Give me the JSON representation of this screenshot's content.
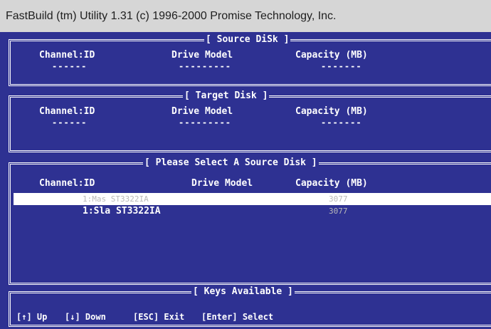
{
  "title_bar": "FastBuild (tm) Utility 1.31 (c) 1996-2000 Promise Technology, Inc.",
  "colors": {
    "background": "#2e3192",
    "text": "#ffffff",
    "dim_text": "#b9b9b9",
    "title_bar": "#d6d6d6"
  },
  "source_panel": {
    "title": "[ Source DiSk ]",
    "headers": {
      "channel": "Channel:ID",
      "model": "Drive Model",
      "capacity": "Capacity (MB)"
    },
    "placeholders": {
      "channel": "------",
      "model": "---------",
      "capacity": "-------"
    }
  },
  "target_panel": {
    "title": "[ Target Disk ]",
    "headers": {
      "channel": "Channel:ID",
      "model": "Drive Model",
      "capacity": "Capacity (MB)"
    },
    "placeholders": {
      "channel": "------",
      "model": "---------",
      "capacity": "-------"
    }
  },
  "select_panel": {
    "title": "[ Please Select A Source Disk ]",
    "headers": {
      "channel": "Channel:ID",
      "model": "Drive Model",
      "capacity": "Capacity (MB)"
    },
    "rows": [
      {
        "channel_model": "1:Mas ST3322IA",
        "capacity": "3077",
        "selected": true
      },
      {
        "channel_model": "1:Sla ST3322IA",
        "capacity": "3077",
        "selected": false
      }
    ]
  },
  "keys_panel": {
    "title": "[ Keys Available ]",
    "keys": [
      {
        "key": "[↑]",
        "action": "Up"
      },
      {
        "key": "[↓]",
        "action": "Down"
      },
      {
        "key": "[ESC]",
        "action": "Exit"
      },
      {
        "key": "[Enter]",
        "action": "Select"
      }
    ]
  }
}
